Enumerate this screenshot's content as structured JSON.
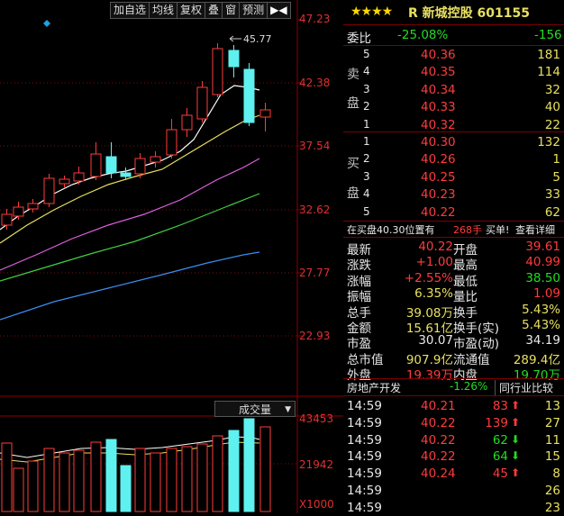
{
  "toolbar": {
    "items": [
      "加自选",
      "均线",
      "复权",
      "叠",
      "窗",
      "预测",
      "▶◀"
    ]
  },
  "price_axis": [
    "47.23",
    "42.38",
    "37.54",
    "32.62",
    "27.77",
    "22.93"
  ],
  "peak_label": "45.77",
  "volume_axis": [
    "43453",
    "21942",
    "X1000"
  ],
  "volume_title": "成交量",
  "stock": {
    "stars": "★★★★",
    "r_mark": "R",
    "name": "新城控股",
    "code": "601155"
  },
  "weibi": {
    "label": "委比",
    "pct": "-25.08%",
    "diff": "-156"
  },
  "sell": {
    "label_top": "卖",
    "label_bottom": "盘",
    "levels": [
      {
        "n": "5",
        "price": "40.36",
        "vol": "181"
      },
      {
        "n": "4",
        "price": "40.35",
        "vol": "114"
      },
      {
        "n": "3",
        "price": "40.34",
        "vol": "32"
      },
      {
        "n": "2",
        "price": "40.33",
        "vol": "40"
      },
      {
        "n": "1",
        "price": "40.32",
        "vol": "22"
      }
    ]
  },
  "buy": {
    "label_top": "买",
    "label_bottom": "盘",
    "levels": [
      {
        "n": "1",
        "price": "40.30",
        "vol": "132"
      },
      {
        "n": "2",
        "price": "40.26",
        "vol": "1"
      },
      {
        "n": "3",
        "price": "40.25",
        "vol": "5"
      },
      {
        "n": "4",
        "price": "40.23",
        "vol": "33"
      },
      {
        "n": "5",
        "price": "40.22",
        "vol": "62"
      }
    ]
  },
  "position_line": {
    "text": "在买盘40.30位置有",
    "hands": "268手",
    "buy": "买单!",
    "detail": "查看详细"
  },
  "quote": {
    "rows": [
      [
        {
          "k": "最新",
          "v": "40.22",
          "c": "red"
        },
        {
          "k": "开盘",
          "v": "39.61",
          "c": "red"
        }
      ],
      [
        {
          "k": "涨跌",
          "v": "+1.00",
          "c": "red"
        },
        {
          "k": "最高",
          "v": "40.99",
          "c": "red"
        }
      ],
      [
        {
          "k": "涨幅",
          "v": "+2.55%",
          "c": "red"
        },
        {
          "k": "最低",
          "v": "38.50",
          "c": "grn"
        }
      ],
      [
        {
          "k": "振幅",
          "v": "6.35%",
          "c": "yel"
        },
        {
          "k": "量比",
          "v": "1.09",
          "c": "red"
        }
      ],
      [
        {
          "k": "总手",
          "v": "39.08万",
          "c": "yel"
        },
        {
          "k": "换手",
          "v": "5.43%",
          "c": "yel"
        }
      ],
      [
        {
          "k": "金额",
          "v": "15.61亿",
          "c": "yel"
        },
        {
          "k": "换手(实)",
          "v": "5.43%",
          "c": "yel"
        }
      ],
      [
        {
          "k": "市盈",
          "v": "30.07",
          "c": "wht"
        },
        {
          "k": "市盈(动)",
          "v": "34.19",
          "c": "wht"
        }
      ],
      [
        {
          "k": "总市值",
          "v": "907.9亿",
          "c": "yel"
        },
        {
          "k": "流通值",
          "v": "289.4亿",
          "c": "yel"
        }
      ],
      [
        {
          "k": "外盘",
          "v": "19.39万",
          "c": "red"
        },
        {
          "k": "内盘",
          "v": "19.70万",
          "c": "grn"
        }
      ]
    ]
  },
  "sector": {
    "name": "房地产开发",
    "pct": "-1.26%",
    "btn": "同行业比较"
  },
  "ticks": [
    {
      "t": "14:59",
      "p": "40.21",
      "v": "83",
      "dir": "up",
      "n": "13"
    },
    {
      "t": "14:59",
      "p": "40.22",
      "v": "139",
      "dir": "up",
      "n": "27"
    },
    {
      "t": "14:59",
      "p": "40.22",
      "v": "62",
      "dir": "down",
      "n": "11"
    },
    {
      "t": "14:59",
      "p": "40.22",
      "v": "64",
      "dir": "down",
      "n": "15"
    },
    {
      "t": "14:59",
      "p": "40.24",
      "v": "45",
      "dir": "up",
      "n": "8"
    },
    {
      "t": "14:59",
      "p": "",
      "v": "",
      "dir": "",
      "n": "26"
    },
    {
      "t": "14:59",
      "p": "",
      "v": "",
      "dir": "",
      "n": "23"
    }
  ]
}
